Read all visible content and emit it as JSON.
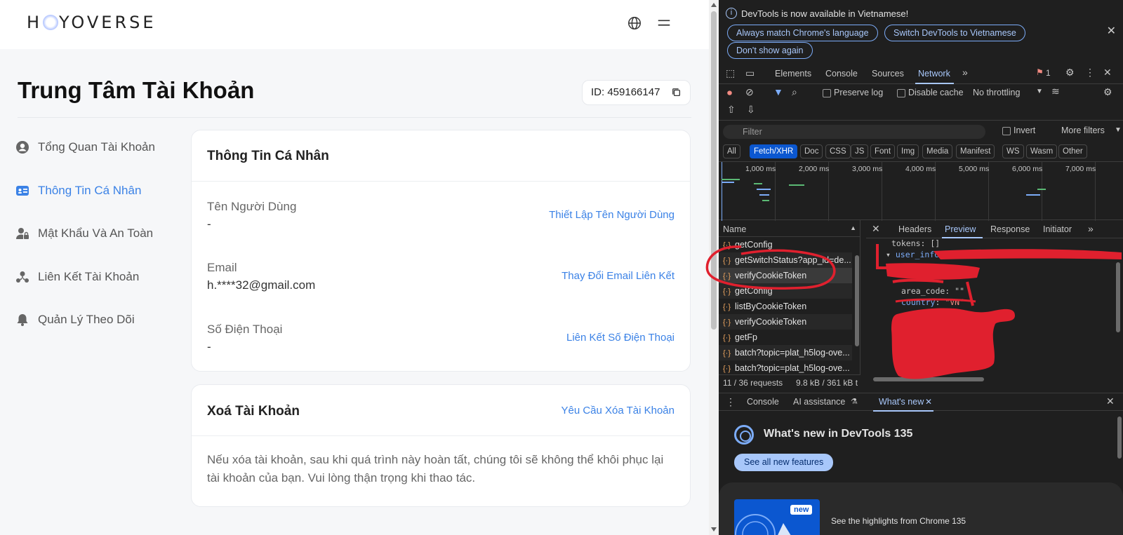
{
  "site": {
    "logo_text_left": "H",
    "logo_text_right": "YOVERSE",
    "page_title": "Trung Tâm Tài Khoản",
    "account_id": "ID: 459166147"
  },
  "sidebar": {
    "items": [
      {
        "label": "Tổng Quan Tài Khoản",
        "icon": "user-circle-icon",
        "active": false
      },
      {
        "label": "Thông Tin Cá Nhân",
        "icon": "id-card-icon",
        "active": true
      },
      {
        "label": "Mật Khẩu Và An Toàn",
        "icon": "user-lock-icon",
        "active": false
      },
      {
        "label": "Liên Kết Tài Khoản",
        "icon": "link-user-icon",
        "active": false
      },
      {
        "label": "Quản Lý Theo Dõi",
        "icon": "bell-icon",
        "active": false
      }
    ]
  },
  "personal_info": {
    "title": "Thông Tin Cá Nhân",
    "fields": [
      {
        "label": "Tên Người Dùng",
        "value": "-",
        "action": "Thiết Lập Tên Người Dùng"
      },
      {
        "label": "Email",
        "value": "h.****32@gmail.com",
        "action": "Thay Đổi Email Liên Kết"
      },
      {
        "label": "Số Điện Thoại",
        "value": "-",
        "action": "Liên Kết Số Điện Thoại"
      }
    ]
  },
  "delete_account": {
    "title": "Xoá Tài Khoản",
    "action": "Yêu Cầu Xóa Tài Khoản",
    "description": "Nếu xóa tài khoản, sau khi quá trình này hoàn tất, chúng tôi sẽ không thể khôi phục lại tài khoản của bạn. Vui lòng thận trọng khi thao tác."
  },
  "devtools": {
    "infobar": {
      "message": "DevTools is now available in Vietnamese!",
      "btn_match": "Always match Chrome's language",
      "btn_switch": "Switch DevTools to Vietnamese",
      "btn_dont_show": "Don't show again"
    },
    "tabs": [
      "Elements",
      "Console",
      "Sources",
      "Network"
    ],
    "active_tab": "Network",
    "issues_count": "1",
    "toolbar": {
      "preserve_log": "Preserve log",
      "disable_cache": "Disable cache",
      "throttling": "No throttling"
    },
    "filter": {
      "placeholder": "Filter",
      "invert": "Invert",
      "more_filters": "More filters"
    },
    "types": [
      "All",
      "Fetch/XHR",
      "Doc",
      "CSS",
      "JS",
      "Font",
      "Img",
      "Media",
      "Manifest",
      "WS",
      "Wasm",
      "Other"
    ],
    "active_type": "Fetch/XHR",
    "timeline_labels": [
      "1,000 ms",
      "2,000 ms",
      "3,000 ms",
      "4,000 ms",
      "5,000 ms",
      "6,000 ms",
      "7,000 ms"
    ],
    "requests_header": "Name",
    "requests": [
      "getConfig",
      "getSwitchStatus?app_id=de...",
      "verifyCookieToken",
      "getConfig",
      "listByCookieToken",
      "verifyCookieToken",
      "getFp",
      "batch?topic=plat_h5log-ove...",
      "batch?topic=plat_h5log-ove..."
    ],
    "selected_request": "verifyCookieToken",
    "preview_tabs": [
      "Headers",
      "Preview",
      "Response",
      "Initiator"
    ],
    "active_preview_tab": "Preview",
    "preview": {
      "line1": "tokens: []",
      "line2_key": "user_info",
      "line3": "area_code: \"\"",
      "line4_key": "country",
      "line4_val": "\"VN\""
    },
    "status": {
      "requests": "11 / 36 requests",
      "size": "9.8 kB / 361 kB t"
    },
    "drawer_tabs": [
      "Console",
      "AI assistance",
      "What's new"
    ],
    "active_drawer_tab": "What's new",
    "whats_new": {
      "title": "What's new in DevTools 135",
      "button": "See all new features",
      "badge": "new",
      "highlight": "See the highlights from Chrome 135"
    }
  },
  "colors": {
    "accent": "#3b82e6",
    "devtools_bg": "#1f1f1f",
    "devtools_accent": "#a8c7fa",
    "annotation_red": "#e0202e"
  }
}
